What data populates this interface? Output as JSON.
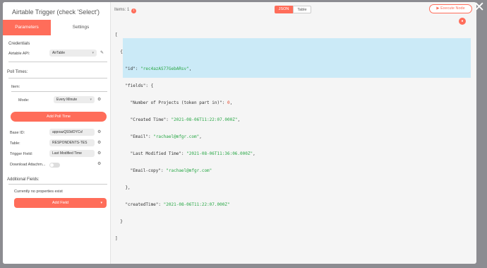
{
  "title": "Airtable Trigger (check 'Select')",
  "tabs": {
    "parameters": "Parameters",
    "settings": "Settings"
  },
  "credentials": {
    "heading": "Credentials",
    "api_label": "Airtable API:",
    "api_value": "AirTable"
  },
  "poll": {
    "heading": "Poll Times:",
    "item_label": "Item:",
    "mode_label": "Mode:",
    "mode_value": "Every Minute",
    "add_button": "Add Poll Time"
  },
  "fields": {
    "base_id_label": "Base ID:",
    "base_id_value": "appoazQ93dOYCs!",
    "table_label": "Table:",
    "table_value": "RESPONDENTS-TES",
    "trigger_label": "Trigger Field:",
    "trigger_value": "Last Modified Time",
    "download_label": "Download Attachm..."
  },
  "additional": {
    "heading": "Additional Fields:",
    "empty_text": "Currently no properties exist",
    "add_button": "Add Field"
  },
  "output": {
    "items_label": "Items: 1",
    "info_icon_glyph": "i",
    "view_json": "JSON",
    "view_table": "Table",
    "execute_button": "Execute Node",
    "execute_badge_glyph": "●"
  },
  "record": {
    "id": "rec4azAS77GebARsv",
    "fields": {
      "number_of_projects": 0,
      "created_time": "2021-08-06T11:22:07.000Z",
      "email": "rachael@mfgr.com",
      "last_modified_time": "2021-08-06T11:36:06.000Z",
      "email_copy": "rachael@mfgr.com"
    },
    "createdTime": "2021-08-06T11:22:07.000Z"
  },
  "accent": "#ff6d5a",
  "icons": {
    "close": "close-icon",
    "edit": "pencil-icon",
    "settings": "cog-icon",
    "info": "info-icon",
    "execute": "play-icon"
  }
}
